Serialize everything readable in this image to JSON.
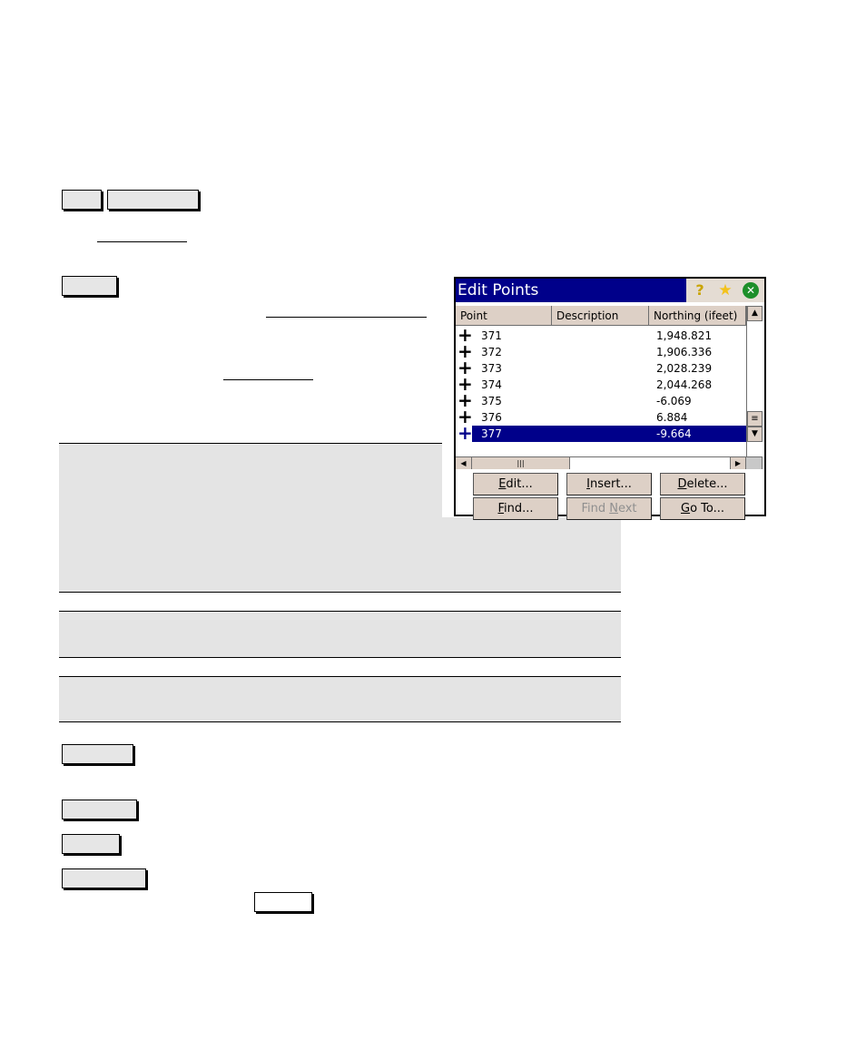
{
  "document": {
    "redacted_text": true,
    "keys": [
      {
        "id": "key-1",
        "label": ""
      },
      {
        "id": "key-2",
        "label": ""
      },
      {
        "id": "key-3",
        "label": ""
      },
      {
        "id": "key-4",
        "label": ""
      },
      {
        "id": "key-5",
        "label": ""
      },
      {
        "id": "key-6",
        "label": ""
      },
      {
        "id": "key-7",
        "label": ""
      },
      {
        "id": "key-8",
        "label": ""
      }
    ],
    "links": [
      {
        "label": ""
      },
      {
        "label": ""
      },
      {
        "label": ""
      }
    ],
    "notes": [
      {
        "text": ""
      },
      {
        "text": ""
      },
      {
        "text": ""
      }
    ]
  },
  "screenshot": {
    "window_title": "Edit Points",
    "title_icons": [
      "help-icon",
      "favorites-icon",
      "close-icon"
    ],
    "columns": [
      "Point",
      "Description",
      "Northing (ifeet)"
    ],
    "rows": [
      {
        "point": "371",
        "description": "",
        "northing": "1,948.821",
        "selected": false
      },
      {
        "point": "372",
        "description": "",
        "northing": "1,906.336",
        "selected": false
      },
      {
        "point": "373",
        "description": "",
        "northing": "2,028.239",
        "selected": false
      },
      {
        "point": "374",
        "description": "",
        "northing": "2,044.268",
        "selected": false
      },
      {
        "point": "375",
        "description": "",
        "northing": "-6.069",
        "selected": false
      },
      {
        "point": "376",
        "description": "",
        "northing": "6.884",
        "selected": false
      },
      {
        "point": "377",
        "description": "",
        "northing": "-9.664",
        "selected": true
      }
    ],
    "buttons": [
      {
        "label": "Edit...",
        "mnemonic": "E",
        "enabled": true
      },
      {
        "label": "Insert...",
        "mnemonic": "I",
        "enabled": true
      },
      {
        "label": "Delete...",
        "mnemonic": "D",
        "enabled": true
      },
      {
        "label": "Find...",
        "mnemonic": "F",
        "enabled": true
      },
      {
        "label": "Find Next",
        "mnemonic": "N",
        "enabled": false
      },
      {
        "label": "Go To...",
        "mnemonic": "G",
        "enabled": true
      }
    ],
    "colors": {
      "titlebar": "#00008a",
      "selection": "#00008a",
      "button_face": "#ddd0c6"
    }
  }
}
